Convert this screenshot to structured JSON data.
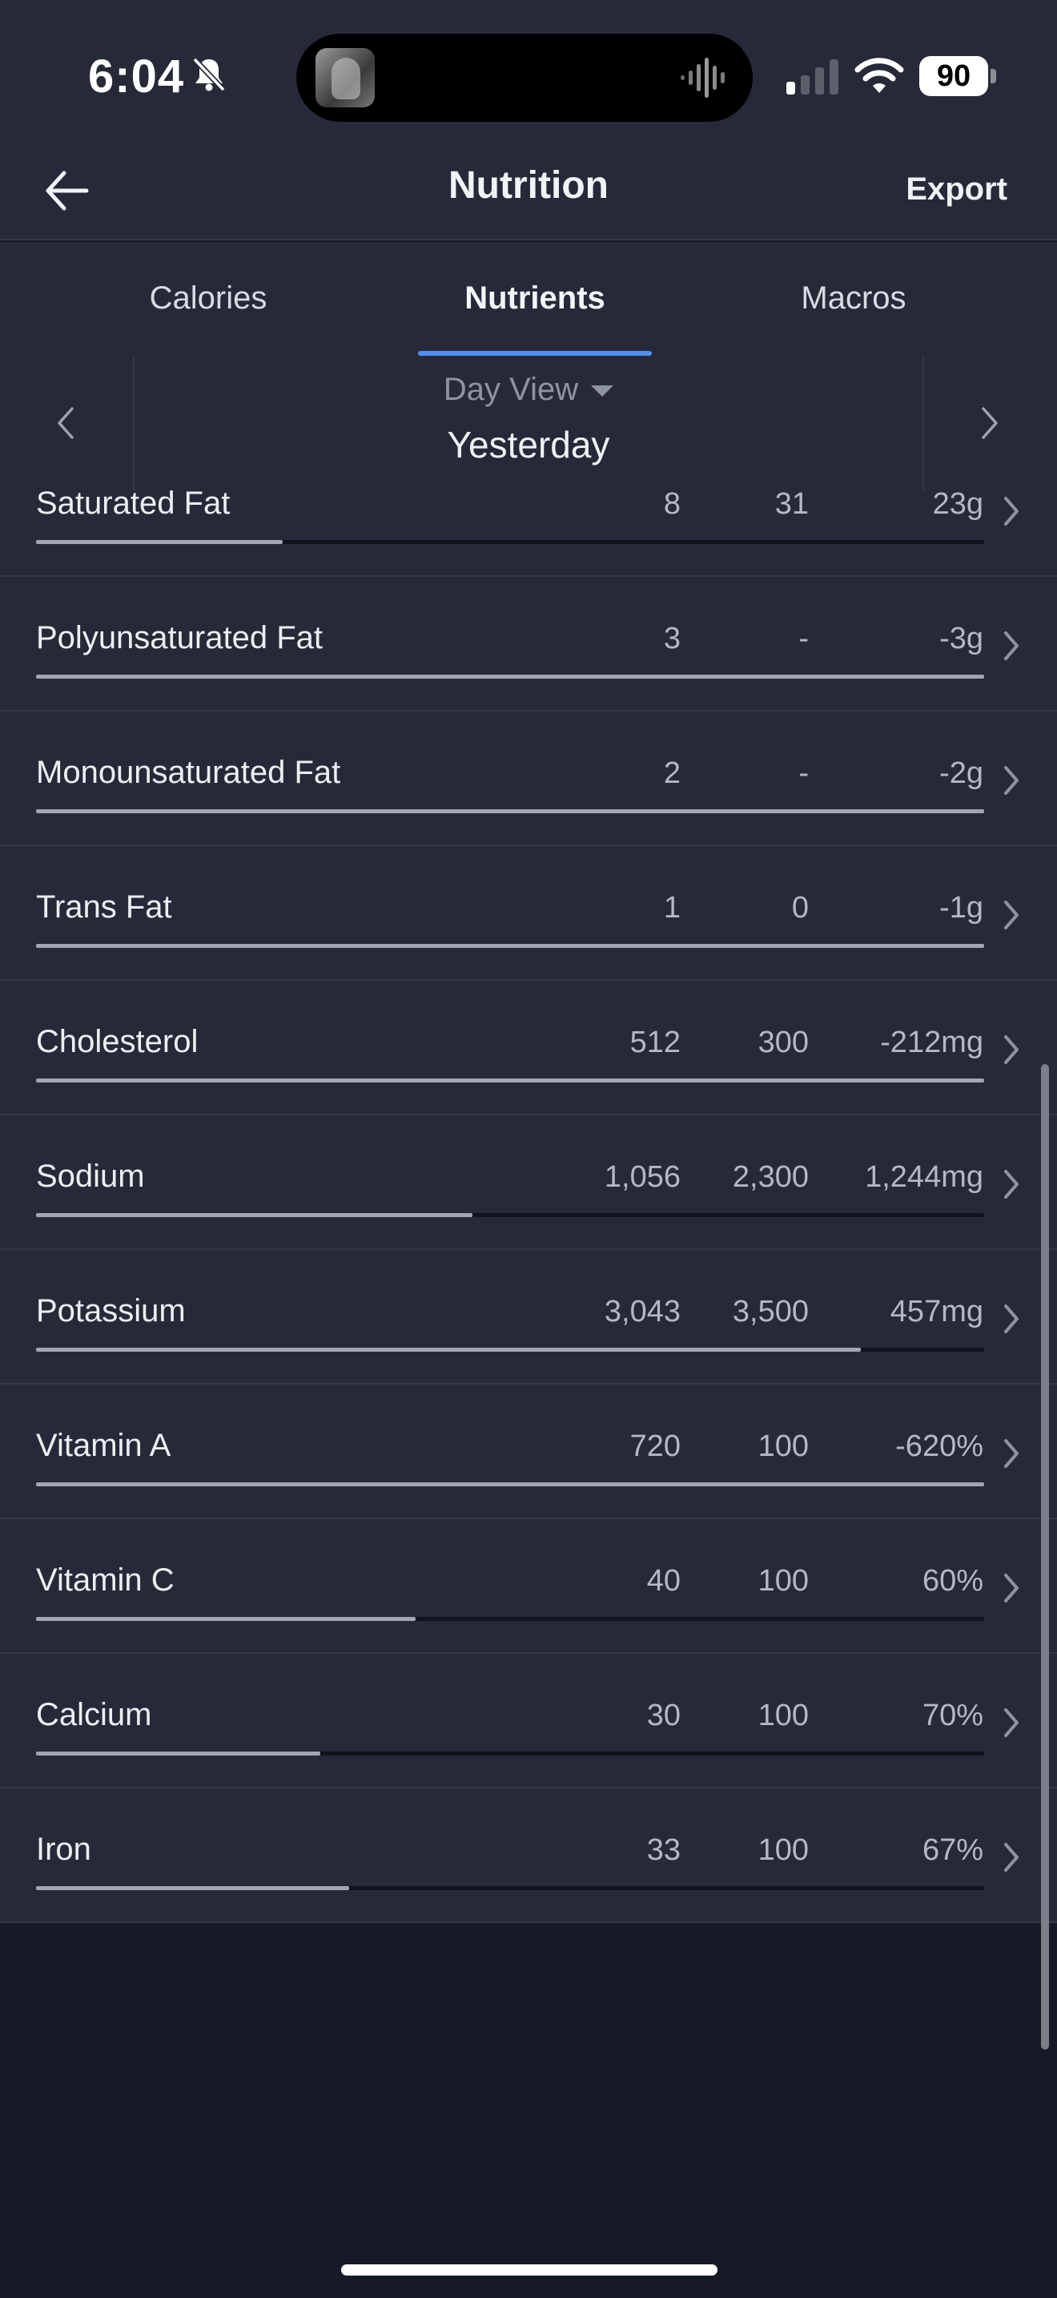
{
  "status_bar": {
    "time": "6:04",
    "battery_level": "90",
    "icons": [
      "bell-slash-icon",
      "album-art-icon",
      "audio-waveform-icon",
      "cellular-signal-icon",
      "wifi-icon",
      "battery-icon"
    ]
  },
  "nav": {
    "back_icon": "arrow-left-icon",
    "title": "Nutrition",
    "export_label": "Export"
  },
  "tabs": [
    {
      "label": "Calories",
      "active": false
    },
    {
      "label": "Nutrients",
      "active": true
    },
    {
      "label": "Macros",
      "active": false
    }
  ],
  "day_selector": {
    "view_label": "Day View",
    "day_label": "Yesterday",
    "prev_icon": "chevron-left-icon",
    "next_icon": "chevron-right-icon"
  },
  "nutrients": [
    {
      "name": "Saturated Fat",
      "total": "8",
      "goal": "31",
      "left": "23g",
      "progress": 0.26
    },
    {
      "name": "Polyunsaturated Fat",
      "total": "3",
      "goal": "-",
      "left": "-3g",
      "progress": 1.0
    },
    {
      "name": "Monounsaturated Fat",
      "total": "2",
      "goal": "-",
      "left": "-2g",
      "progress": 1.0
    },
    {
      "name": "Trans Fat",
      "total": "1",
      "goal": "0",
      "left": "-1g",
      "progress": 1.0
    },
    {
      "name": "Cholesterol",
      "total": "512",
      "goal": "300",
      "left": "-212mg",
      "progress": 1.0
    },
    {
      "name": "Sodium",
      "total": "1,056",
      "goal": "2,300",
      "left": "1,244mg",
      "progress": 0.46
    },
    {
      "name": "Potassium",
      "total": "3,043",
      "goal": "3,500",
      "left": "457mg",
      "progress": 0.87
    },
    {
      "name": "Vitamin A",
      "total": "720",
      "goal": "100",
      "left": "-620%",
      "progress": 1.0
    },
    {
      "name": "Vitamin C",
      "total": "40",
      "goal": "100",
      "left": "60%",
      "progress": 0.4
    },
    {
      "name": "Calcium",
      "total": "30",
      "goal": "100",
      "left": "70%",
      "progress": 0.3
    },
    {
      "name": "Iron",
      "total": "33",
      "goal": "100",
      "left": "67%",
      "progress": 0.33
    }
  ],
  "colors": {
    "background": "#161a26",
    "panel": "#262a38",
    "accent": "#4f8ff2",
    "bar_fill": "#a2a6b2",
    "bar_track": "#10131c"
  }
}
